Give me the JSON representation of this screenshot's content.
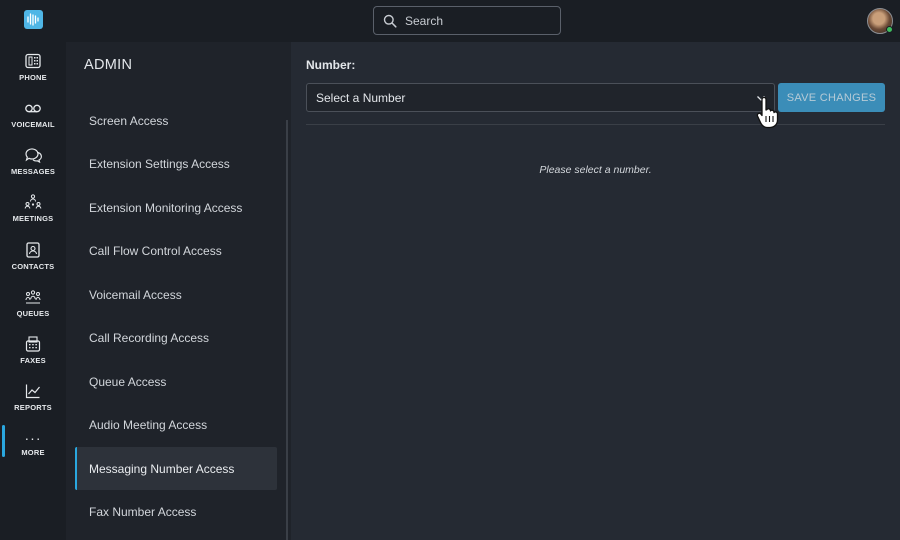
{
  "search": {
    "placeholder": "Search"
  },
  "rail": {
    "items": [
      {
        "label": "PHONE",
        "icon": "phone-icon"
      },
      {
        "label": "VOICEMAIL",
        "icon": "voicemail-icon"
      },
      {
        "label": "MESSAGES",
        "icon": "messages-icon"
      },
      {
        "label": "MEETINGS",
        "icon": "meetings-icon"
      },
      {
        "label": "CONTACTS",
        "icon": "contacts-icon"
      },
      {
        "label": "QUEUES",
        "icon": "queues-icon"
      },
      {
        "label": "FAXES",
        "icon": "fax-icon"
      },
      {
        "label": "REPORTS",
        "icon": "reports-icon"
      },
      {
        "label": "MORE",
        "icon": "more-icon",
        "glyph": "···"
      }
    ]
  },
  "admin": {
    "title": "ADMIN",
    "items": [
      "Screen Access",
      "Extension Settings Access",
      "Extension Monitoring Access",
      "Call Flow Control Access",
      "Voicemail Access",
      "Call Recording Access",
      "Queue Access",
      "Audio Meeting Access",
      "Messaging Number Access",
      "Fax Number Access"
    ],
    "active_item": "Messaging Number Access"
  },
  "main": {
    "number_label": "Number:",
    "select_value": "Select a Number",
    "save_label": "SAVE CHANGES",
    "empty_message": "Please select a number."
  },
  "colors": {
    "accent": "#2aa7df",
    "save_button": "#3f9fd0",
    "status_online": "#3fbf5f"
  }
}
